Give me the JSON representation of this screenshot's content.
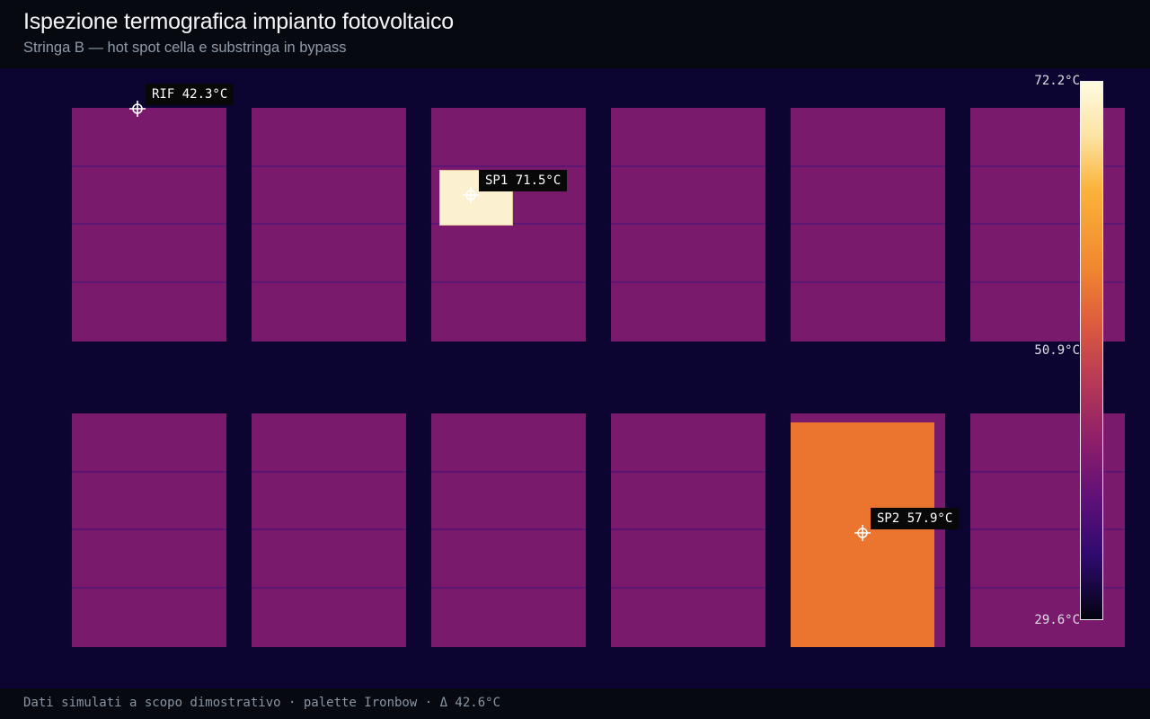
{
  "header": {
    "title": "Ispezione termografica impianto fotovoltaico",
    "subtitle": "Stringa B — hot spot cella e substringa in bypass"
  },
  "thermal_image": {
    "palette": "Ironbow",
    "panel_color": "#791a6c",
    "background_color": "#0c0531",
    "panel_rows": 2,
    "panels_per_row": 6,
    "hot_areas": [
      {
        "id": "SP1",
        "kind": "hot spot cella",
        "color": "#fbf1d1"
      },
      {
        "id": "SP2",
        "kind": "substringa in bypass",
        "color": "#eb742f"
      }
    ]
  },
  "markers": [
    {
      "name": "RIF",
      "label": "RIF 42.3°C",
      "temperature_c": 42.3
    },
    {
      "name": "SP1",
      "label": "SP1 71.5°C",
      "temperature_c": 71.5
    },
    {
      "name": "SP2",
      "label": "SP2 57.9°C",
      "temperature_c": 57.9
    }
  ],
  "colorbar": {
    "max_label": "72.2°C",
    "mid_label": "50.9°C",
    "min_label": "29.6°C",
    "max_c": 72.2,
    "min_c": 29.6
  },
  "footer": {
    "text": "Dati simulati a scopo dimostrativo · palette Ironbow · Δ 42.6°C"
  }
}
